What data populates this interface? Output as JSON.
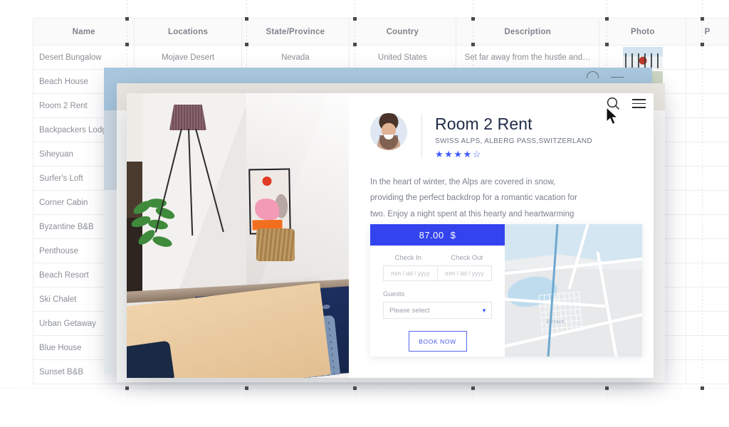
{
  "table": {
    "columns": [
      "Name",
      "Locations",
      "State/Province",
      "Country",
      "Description",
      "Photo",
      "P"
    ],
    "rows": [
      {
        "name": "Desert Bungalow",
        "location": "Mojave Desert",
        "state": "Nevada",
        "country": "United States",
        "description": "Set far away from the hustle and…",
        "photo": "winter-cabin-thumbnail"
      },
      {
        "name": "Beach House",
        "location": "",
        "state": "",
        "country": "",
        "description": "",
        "photo": "plant-thumbnail"
      },
      {
        "name": "Room 2 Rent",
        "location": "",
        "state": "",
        "country": "",
        "description": "",
        "photo": ""
      },
      {
        "name": "Backpackers Lodge",
        "location": "",
        "state": "",
        "country": "",
        "description": "",
        "photo": ""
      },
      {
        "name": "Siheyuan",
        "location": "",
        "state": "",
        "country": "",
        "description": "",
        "photo": ""
      },
      {
        "name": "Surfer's Loft",
        "location": "",
        "state": "",
        "country": "",
        "description": "",
        "photo": ""
      },
      {
        "name": "Corner Cabin",
        "location": "",
        "state": "",
        "country": "",
        "description": "",
        "photo": ""
      },
      {
        "name": "Byzantine B&B",
        "location": "",
        "state": "",
        "country": "",
        "description": "",
        "photo": ""
      },
      {
        "name": "Penthouse",
        "location": "",
        "state": "",
        "country": "",
        "description": "",
        "photo": ""
      },
      {
        "name": "Beach Resort",
        "location": "",
        "state": "",
        "country": "",
        "description": "",
        "photo": ""
      },
      {
        "name": "Ski Chalet",
        "location": "",
        "state": "",
        "country": "",
        "description": "",
        "photo": ""
      },
      {
        "name": "Urban Getaway",
        "location": "",
        "state": "",
        "country": "",
        "description": "",
        "photo": ""
      },
      {
        "name": "Blue House",
        "location": "",
        "state": "",
        "country": "",
        "description": "",
        "photo": ""
      },
      {
        "name": "Sunset B&B",
        "location": "",
        "state": "",
        "country": "",
        "description": "",
        "photo": ""
      }
    ]
  },
  "detail_card": {
    "hero_photo_alt": "interior-room-with-floor-lamp-plant-and-framed-art",
    "avatar_alt": "smiling-man-avatar",
    "title": "Room 2 Rent",
    "subtitle": "SWISS ALPS, ALBERG PASS,SWITZERLAND",
    "rating": {
      "filled": 4,
      "total": 5,
      "filled_glyph": "★",
      "empty_glyph": "☆"
    },
    "description": "In the heart of winter, the Alps are covered in snow, providing the perfect backdrop for a romantic vacation for two. Enjoy a night spent at this hearty and heartwarming location.",
    "booking": {
      "price": "87.00",
      "currency": "$",
      "check_in_label": "Check In",
      "check_out_label": "Check Out",
      "check_in_placeholder": "mm / dd / yyyy",
      "check_out_placeholder": "mm / dd / yyyy",
      "guests_label": "Guests",
      "guests_value": "Please select",
      "guests_chevron": "▼",
      "book_button": "BOOK NOW"
    },
    "map": {
      "place_label": "Zurzach"
    }
  },
  "overlay": {
    "search_icon": "search-icon",
    "menu_icon": "hamburger-menu-icon",
    "cursor": "mouse-pointer-cursor"
  },
  "colors": {
    "accent_blue": "#3344ee",
    "star_blue": "#3d5afe",
    "text_dark": "#1f2b46",
    "text_muted": "#7b818c",
    "table_header_bg": "#fafafa"
  }
}
